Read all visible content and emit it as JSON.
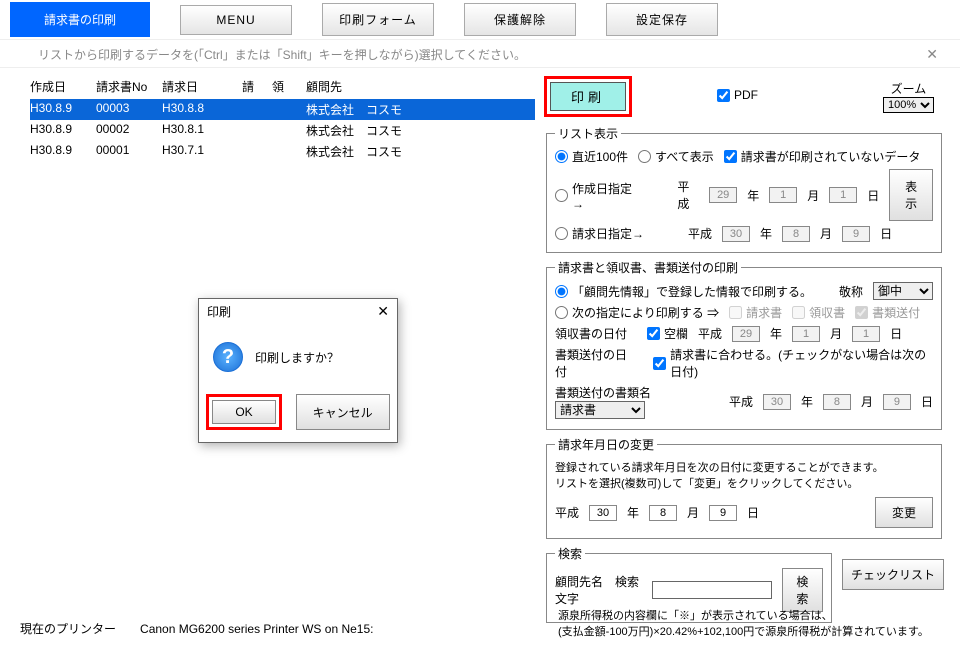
{
  "toolbar": {
    "primary": "請求書の印刷",
    "menu": "MENU",
    "form": "印刷フォーム",
    "unlock": "保護解除",
    "save_settings": "設定保存"
  },
  "instruction": "リストから印刷するデータを(「Ctrl」または「Shift」キーを押しながら)選択してください。",
  "table": {
    "headers": {
      "created": "作成日",
      "no": "請求書No",
      "billed": "請求日",
      "sei": "請",
      "ryo": "領",
      "cust": "顧問先"
    },
    "rows": [
      {
        "created": "H30.8.9",
        "no": "00003",
        "billed": "H30.8.8",
        "sei": "",
        "ryo": "",
        "cust": "株式会社　コスモ"
      },
      {
        "created": "H30.8.9",
        "no": "00002",
        "billed": "H30.8.1",
        "sei": "",
        "ryo": "",
        "cust": "株式会社　コスモ"
      },
      {
        "created": "H30.8.9",
        "no": "00001",
        "billed": "H30.7.1",
        "sei": "",
        "ryo": "",
        "cust": "株式会社　コスモ"
      }
    ]
  },
  "right": {
    "print_btn": "印刷",
    "pdf": "PDF",
    "zoom_label": "ズーム",
    "zoom_value": "100%",
    "list": {
      "legend": "リスト表示",
      "recent100": "直近100件",
      "all": "すべて表示",
      "unprinted": "請求書が印刷されていないデータ",
      "created_range": "作成日指定→",
      "billed_range": "請求日指定→",
      "era": "平成",
      "y1": "29",
      "m1": "1",
      "d1": "1",
      "y2": "30",
      "m2": "8",
      "d2": "9",
      "year_u": "年",
      "month_u": "月",
      "day_u": "日",
      "show_btn": "表示"
    },
    "docs": {
      "legend": "請求書と領収書、書類送付の印刷",
      "opt1": "「顧問先情報」で登録した情報で印刷する。",
      "honorific": "敬称",
      "honorific_val": "御中",
      "opt2": "次の指定により印刷する ⇒",
      "invoice": "請求書",
      "receipt": "領収書",
      "docsend": "書類送付",
      "receipt_date": "領収書の日付",
      "blank": "空欄",
      "era": "平成",
      "ry": "29",
      "rm": "1",
      "rd": "1",
      "doc_date": "書類送付の日付",
      "match_invoice": "請求書に合わせる。(チェックがない場合は次の日付)",
      "doc_name_label": "書類送付の書類名",
      "doc_name_val": "請求書",
      "dy": "30",
      "dm": "8",
      "dd": "9",
      "year_u": "年",
      "month_u": "月",
      "day_u": "日"
    },
    "change": {
      "legend": "請求年月日の変更",
      "desc1": "登録されている請求年月日を次の日付に変更することができます。",
      "desc2": "リストを選択(複数可)して「変更」をクリックしてください。",
      "era": "平成",
      "y": "30",
      "m": "8",
      "d": "9",
      "year_u": "年",
      "month_u": "月",
      "day_u": "日",
      "btn": "変更"
    },
    "search": {
      "legend": "検索",
      "label": "顧問先名　検索文字",
      "btn": "検索"
    },
    "checklist_btn": "チェックリスト"
  },
  "footer": {
    "note": "源泉所得税の内容欄に「※」が表示されている場合は、\n(支払金額-100万円)×20.42%+102,100円で源泉所得税が計算されています。",
    "printer_label": "現在のプリンター",
    "printer_name": "Canon MG6200 series Printer WS on Ne15:"
  },
  "dialog": {
    "title": "印刷",
    "message": "印刷しますか？",
    "ok": "OK",
    "cancel": "キャンセル"
  }
}
